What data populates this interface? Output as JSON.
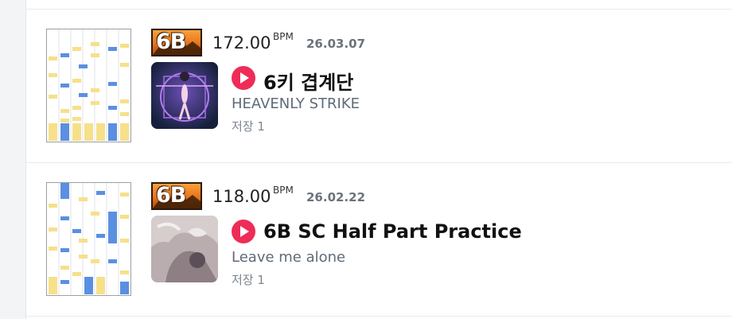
{
  "charts": [
    {
      "level": "6B",
      "bpm": "172.00",
      "bpm_unit": "BPM",
      "date": "26.03.07",
      "title": "6키 겹계단",
      "artist": "HEAVENLY STRIKE",
      "saves": "저장 1",
      "icons": {
        "play": "play-icon",
        "jacket": "jacket-art"
      }
    },
    {
      "level": "6B",
      "bpm": "118.00",
      "bpm_unit": "BPM",
      "date": "26.02.22",
      "title": "6B SC Half Part Practice",
      "artist": "Leave me alone",
      "saves": "저장 1",
      "icons": {
        "play": "play-icon",
        "jacket": "jacket-art"
      }
    }
  ],
  "colors": {
    "play": "#ee2c57",
    "badge": "#e8731c",
    "white_note": "#f6e08a",
    "blue_note": "#5b8fe0",
    "date": "#6a737d",
    "artist": "#5f6b78"
  }
}
